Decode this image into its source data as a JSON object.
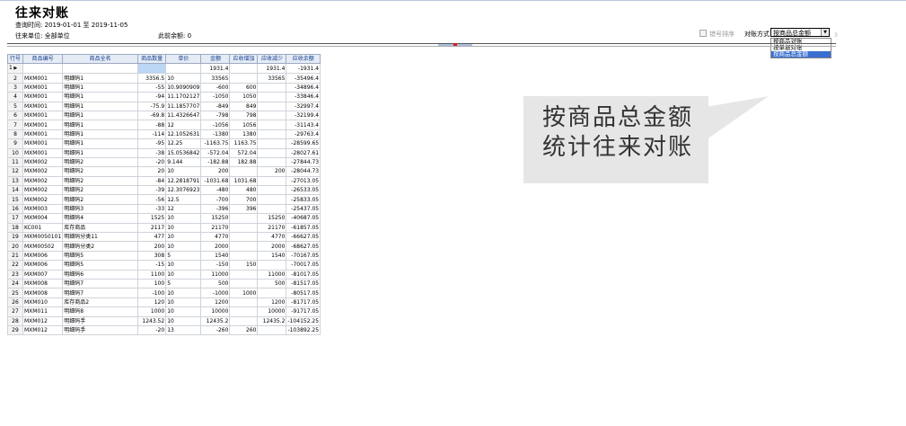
{
  "page": {
    "title": "往来对账",
    "query_time_label": "查询时间:",
    "date_from": "2019-01-01",
    "date_to_word": "至",
    "date_to": "2019-11-05",
    "unit_label": "往来单位:",
    "unit_value": "全部单位",
    "prev_balance_label": "此前余额:",
    "prev_balance_value": "0"
  },
  "toolbar": {
    "checkbox_label": "错号排序",
    "method_label": "对账方式",
    "method_selected": "按商品总金额",
    "method_options": [
      "按商品对账",
      "按单据对账",
      "按商品总金额"
    ],
    "extra_mark": "3"
  },
  "grid": {
    "columns": [
      "行号",
      "商品编号",
      "商品全名",
      "商品数量",
      "单价",
      "金额",
      "应收增加",
      "应收减少",
      "应收余额"
    ],
    "rows": [
      [
        "1",
        "",
        "",
        "",
        "",
        "1931.4",
        "",
        "1931.4",
        "-1931.4"
      ],
      [
        "2",
        "MXM001",
        "明细码1",
        "3356.5",
        "10",
        "33565",
        "",
        "33565",
        "-35496.4"
      ],
      [
        "3",
        "MXM001",
        "明细码1",
        "-55",
        "10.9090909",
        "-600",
        "600",
        "",
        "-34896.4"
      ],
      [
        "4",
        "MXM001",
        "明细码1",
        "-94",
        "11.1702127",
        "-1050",
        "1050",
        "",
        "-33846.4"
      ],
      [
        "5",
        "MXM001",
        "明细码1",
        "-75.9",
        "11.1857707",
        "-849",
        "849",
        "",
        "-32997.4"
      ],
      [
        "6",
        "MXM001",
        "明细码1",
        "-69.8",
        "11.4326647",
        "-798",
        "798",
        "",
        "-32199.4"
      ],
      [
        "7",
        "MXM001",
        "明细码1",
        "-88",
        "12",
        "-1056",
        "1056",
        "",
        "-31143.4"
      ],
      [
        "8",
        "MXM001",
        "明细码1",
        "-114",
        "12.1052631",
        "-1380",
        "1380",
        "",
        "-29763.4"
      ],
      [
        "9",
        "MXM001",
        "明细码1",
        "-95",
        "12.25",
        "-1163.75",
        "1163.75",
        "",
        "-28599.65"
      ],
      [
        "10",
        "MXM001",
        "明细码1",
        "-38",
        "15.0536842",
        "-572.04",
        "572.04",
        "",
        "-28027.61"
      ],
      [
        "11",
        "MXM002",
        "明细码2",
        "-20",
        "9.144",
        "-182.88",
        "182.88",
        "",
        "-27844.73"
      ],
      [
        "12",
        "MXM002",
        "明细码2",
        "20",
        "10",
        "200",
        "",
        "200",
        "-28044.73"
      ],
      [
        "13",
        "MXM002",
        "明细码2",
        "-84",
        "12.2818791",
        "-1031.68",
        "1031.68",
        "",
        "-27013.05"
      ],
      [
        "14",
        "MXM002",
        "明细码2",
        "-39",
        "12.3076923",
        "-480",
        "480",
        "",
        "-26533.05"
      ],
      [
        "15",
        "MXM002",
        "明细码2",
        "-56",
        "12.5",
        "-700",
        "700",
        "",
        "-25833.05"
      ],
      [
        "16",
        "MXM003",
        "明细码3",
        "-33",
        "12",
        "-396",
        "396",
        "",
        "-25437.05"
      ],
      [
        "17",
        "MXM004",
        "明细码4",
        "1525",
        "10",
        "15250",
        "",
        "15250",
        "-40687.05"
      ],
      [
        "18",
        "KC001",
        "库存商品",
        "2117",
        "10",
        "21170",
        "",
        "21170",
        "-61857.05"
      ],
      [
        "19",
        "MXM0050101",
        "明细码分类11",
        "477",
        "10",
        "4770",
        "",
        "4770",
        "-66627.05"
      ],
      [
        "20",
        "MXM00502",
        "明细码分类2",
        "200",
        "10",
        "2000",
        "",
        "2000",
        "-68627.05"
      ],
      [
        "21",
        "MXM006",
        "明细码5",
        "308",
        "5",
        "1540",
        "",
        "1540",
        "-70167.05"
      ],
      [
        "22",
        "MXM006",
        "明细码5",
        "-15",
        "10",
        "-150",
        "150",
        "",
        "-70017.05"
      ],
      [
        "23",
        "MXM007",
        "明细码6",
        "1100",
        "10",
        "11000",
        "",
        "11000",
        "-81017.05"
      ],
      [
        "24",
        "MXM008",
        "明细码7",
        "100",
        "5",
        "500",
        "",
        "500",
        "-81517.05"
      ],
      [
        "25",
        "MXM008",
        "明细码7",
        "-100",
        "10",
        "-1000",
        "1000",
        "",
        "-80517.05"
      ],
      [
        "26",
        "MXM010",
        "库存商品2",
        "120",
        "10",
        "1200",
        "",
        "1200",
        "-81717.05"
      ],
      [
        "27",
        "MXM011",
        "明细码8",
        "1000",
        "10",
        "10000",
        "",
        "10000",
        "-91717.05"
      ],
      [
        "28",
        "MXM012",
        "明细码手",
        "1243.52",
        "10",
        "12435.2",
        "",
        "12435.2",
        "-104152.25"
      ],
      [
        "29",
        "MXM012",
        "明细码手",
        "-20",
        "13",
        "-260",
        "260",
        "",
        "-103892.25"
      ]
    ]
  },
  "callout": {
    "line1": "按商品总金额",
    "line2": "统计往来对账",
    "bg_color": "#e6e6e6"
  },
  "colors": {
    "header_text": "#123e8a",
    "header_bg": "#e6ecf6",
    "selected_cell": "#bcd6f6",
    "dropdown_highlight": "#3a6fd0",
    "splitter_mark": "#d81b1b"
  }
}
